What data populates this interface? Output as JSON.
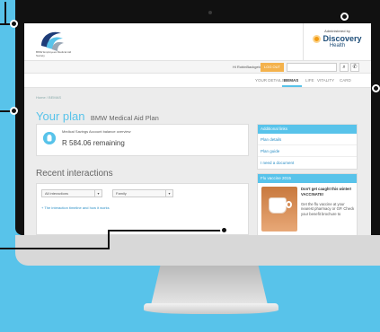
{
  "header": {
    "logo_text": "BMW Employees Medical Aid Society",
    "administered_by": "Administered by",
    "brand_name": "Discovery",
    "brand_sub": "Health"
  },
  "util_bar": {
    "greeting": "Hi RobinBackgeldt",
    "logout_label": "LOG OUT",
    "search_placeholder": "",
    "search_icon": "search-icon",
    "phone_icon": "phone-icon"
  },
  "nav": {
    "tabs": [
      {
        "label": "YOUR DETAILS",
        "active": false
      },
      {
        "label": "BEMAS",
        "active": true
      },
      {
        "label": "LIFE",
        "active": false
      },
      {
        "label": "VITALITY",
        "active": false
      },
      {
        "label": "CARD",
        "active": false
      }
    ]
  },
  "breadcrumb": {
    "home": "Home",
    "sep": "/",
    "current": "BEMAS"
  },
  "plan": {
    "title_prefix": "Your plan",
    "name": "BMW Medical Aid Plan"
  },
  "balance": {
    "label": "Medical Savings Account balance overview",
    "value": "R 584.06 remaining"
  },
  "recent": {
    "title": "Recent interactions",
    "filter_1": "All interactions",
    "filter_2": "Family",
    "timeline_link": "+ The interaction timeline and how it works"
  },
  "sidebar": {
    "links_heading": "Additional links",
    "links": [
      "Plan details",
      "Plan guide",
      "I need a document"
    ],
    "flu_heading": "Flu vaccine 2015",
    "flu_bold": "Don't get caught this winter! VACCINATE!",
    "flu_text": "Get the flu vaccine at your nearest pharmacy or GP. Check your benefit brochure to"
  },
  "colors": {
    "accent": "#58c3ea",
    "logout": "#f4b24c",
    "background": "#58c3ea"
  }
}
